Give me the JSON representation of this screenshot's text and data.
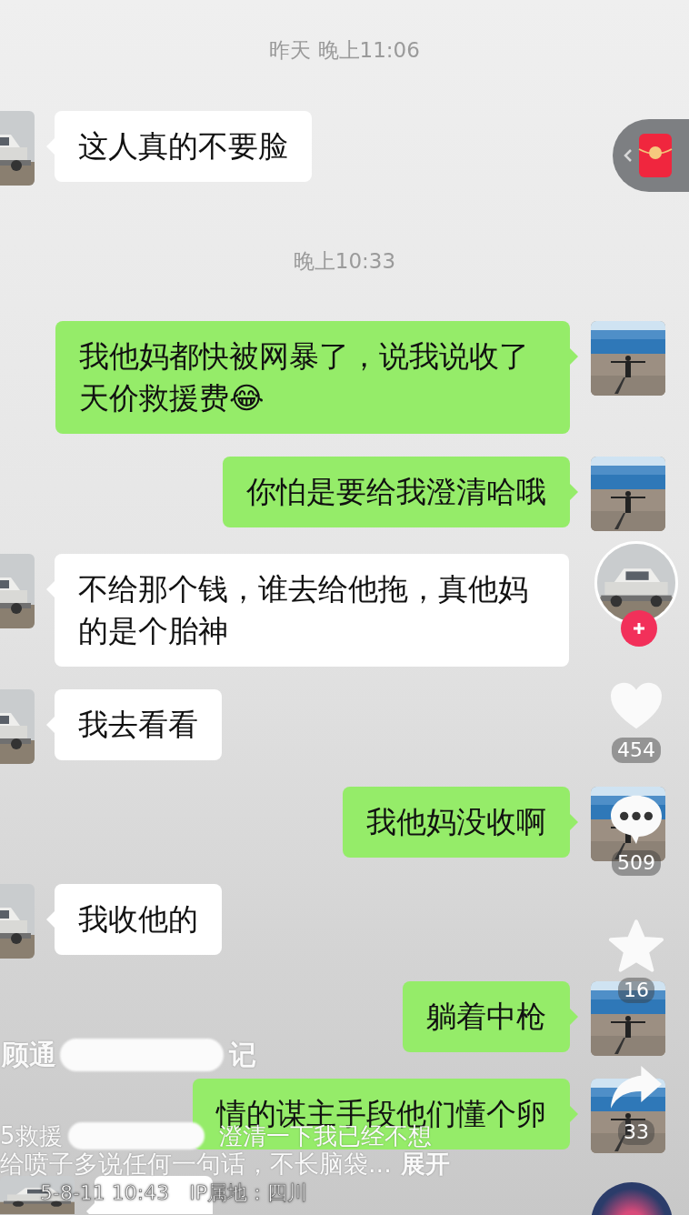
{
  "chat": [
    {
      "kind": "time",
      "text": "昨天 晚上11:06"
    },
    {
      "kind": "incoming",
      "text": "这人真的不要脸"
    },
    {
      "kind": "time",
      "text": "晚上10:33"
    },
    {
      "kind": "outgoing",
      "text": "我他妈都快被网暴了，说我说收了天价救援费😂"
    },
    {
      "kind": "outgoing",
      "text": "你怕是要给我澄清哈哦"
    },
    {
      "kind": "incoming",
      "text": "不给那个钱，谁去给他拖，真他妈的是个胎神"
    },
    {
      "kind": "incoming",
      "text": "我去看看"
    },
    {
      "kind": "outgoing",
      "text": "我他妈没收啊"
    },
    {
      "kind": "incoming",
      "text": "我收他的"
    },
    {
      "kind": "outgoing",
      "text": "躺着中枪"
    },
    {
      "kind": "outgoing",
      "text": "情的谋主手段他们懂个卵"
    },
    {
      "kind": "cut_off"
    }
  ],
  "actions": [
    {
      "kind": "like",
      "count": "454"
    },
    {
      "kind": "comment",
      "count": "509"
    },
    {
      "kind": "favorite",
      "count": "16"
    },
    {
      "kind": "share",
      "count": "33"
    }
  ],
  "caption": {
    "author": "顾通",
    "author_tail": "记",
    "line_1": [
      "5救援",
      "澄清一下我已经不想"
    ],
    "line_2": "给喷子多说任何一句话，不长脑袋...",
    "more": "展开",
    "date": "5-8-11 10:43",
    "location": "IP属地：四川"
  }
}
